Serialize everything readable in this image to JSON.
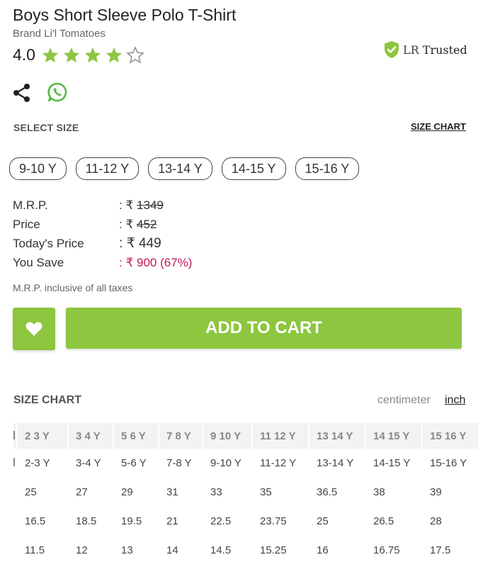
{
  "product": {
    "title": "Boys Short Sleeve Polo T-Shirt",
    "brand": "Brand Li'l Tomatoes",
    "rating": "4.0",
    "stars_filled": 4,
    "stars_total": 5
  },
  "badge": {
    "lr": "LR",
    "trusted": "Trusted"
  },
  "size_select": {
    "heading": "SELECT SIZE",
    "chart_link": "SIZE CHART",
    "sizes": [
      "9-10 Y",
      "11-12 Y",
      "13-14 Y",
      "14-15 Y",
      "15-16 Y"
    ]
  },
  "pricing": {
    "mrp_label": "M.R.P.",
    "mrp_value": "1349",
    "price_label": "Price",
    "price_value": "452",
    "today_label": "Today's Price",
    "today_value": "449",
    "save_label": "You Save",
    "save_value": "₹ 900 (67%)",
    "currency": "₹",
    "sep": ":",
    "note": "M.R.P. inclusive of all taxes"
  },
  "actions": {
    "add_to_cart": "ADD TO CART"
  },
  "size_chart": {
    "heading": "SIZE CHART",
    "unit_cm": "centimeter",
    "unit_inch": "inch",
    "headers": [
      "2 3 Y",
      "3 4 Y",
      "5 6 Y",
      "7 8 Y",
      "9 10 Y",
      "11 12 Y",
      "13 14 Y",
      "14 15 Y",
      "15 16 Y"
    ],
    "rows": [
      [
        "2-3 Y",
        "3-4 Y",
        "5-6 Y",
        "7-8 Y",
        "9-10 Y",
        "11-12 Y",
        "13-14 Y",
        "14-15 Y",
        "15-16 Y"
      ],
      [
        "25",
        "27",
        "29",
        "31",
        "33",
        "35",
        "36.5",
        "38",
        "39"
      ],
      [
        "16.5",
        "18.5",
        "19.5",
        "21",
        "22.5",
        "23.75",
        "25",
        "26.5",
        "28"
      ],
      [
        "11.5",
        "12",
        "13",
        "14",
        "14.5",
        "15.25",
        "16",
        "16.75",
        "17.5"
      ]
    ]
  },
  "colors": {
    "accent": "#8dc63f",
    "save": "#c2185b",
    "shield": "#8dc63f"
  },
  "icons": {
    "share": "share-icon",
    "whatsapp": "whatsapp-icon",
    "wishlist": "heart-icon",
    "trust": "shield-check-icon"
  }
}
